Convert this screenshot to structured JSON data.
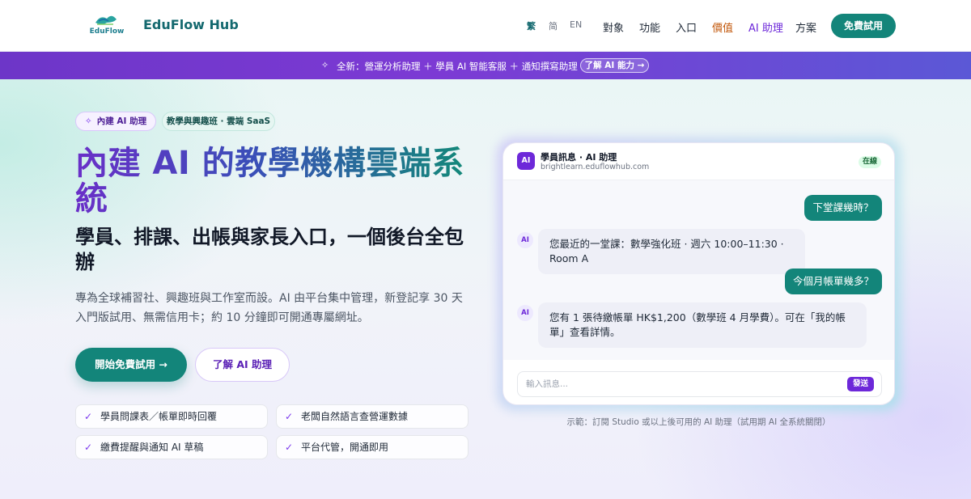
{
  "nav": {
    "logo_text": "EduFlow",
    "brand": "EduFlow Hub",
    "languages": [
      "繁",
      "简",
      "EN"
    ],
    "links": [
      "對象",
      "功能",
      "入口",
      "價值",
      "AI 助理",
      "方案"
    ],
    "cta": "免費試用"
  },
  "banner": {
    "text": "全新：營運分析助理 ＋ 學員 AI 智能客服 ＋ 通知撰寫助理",
    "link": "了解 AI 能力 →"
  },
  "hero": {
    "pill_ai": "內建 AI 助理",
    "pill_saas": "教學與興趣班 · 雲端 SaaS",
    "title": "內建 AI 的教學機構雲端系統",
    "subtitle": "學員、排課、出帳與家長入口，一個後台全包辦",
    "description": "專為全球補習社、興趣班與工作室而設。AI 由平台集中管理，新登記享 30 天入門版試用、無需信用卡；約 10 分鐘即可開通專屬網址。",
    "primary_button": "開始免費試用 →",
    "secondary_button": "了解 AI 助理",
    "features": [
      "學員問課表／帳單即時回覆",
      "老闆自然語言查營運數據",
      "繳費提醒與通知 AI 草稿",
      "平台代管，開通即用"
    ]
  },
  "chat": {
    "badge": "AI",
    "title": "學員訊息 · AI 助理",
    "domain": "brightlearn.eduflowhub.com",
    "status": "在線",
    "messages": [
      {
        "role": "user",
        "text": "下堂課幾時？"
      },
      {
        "role": "ai",
        "text": "您最近的一堂課：數學強化班 · 週六 10:00–11:30 · Room A"
      },
      {
        "role": "user",
        "text": "今個月帳單幾多？"
      },
      {
        "role": "ai",
        "text": "您有 1 張待繳帳單 HK$1,200（數學班 4 月學費）。可在「我的帳單」查看詳情。"
      }
    ],
    "input_placeholder": "輸入訊息...",
    "send": "發送",
    "caption": "示範：訂閱 Studio 或以上後可用的 AI 助理（試用期 AI 全系統關閉）"
  },
  "colors": {
    "teal": "#13857a",
    "purple": "#6d28d9",
    "orange_link": "#c2580c"
  }
}
